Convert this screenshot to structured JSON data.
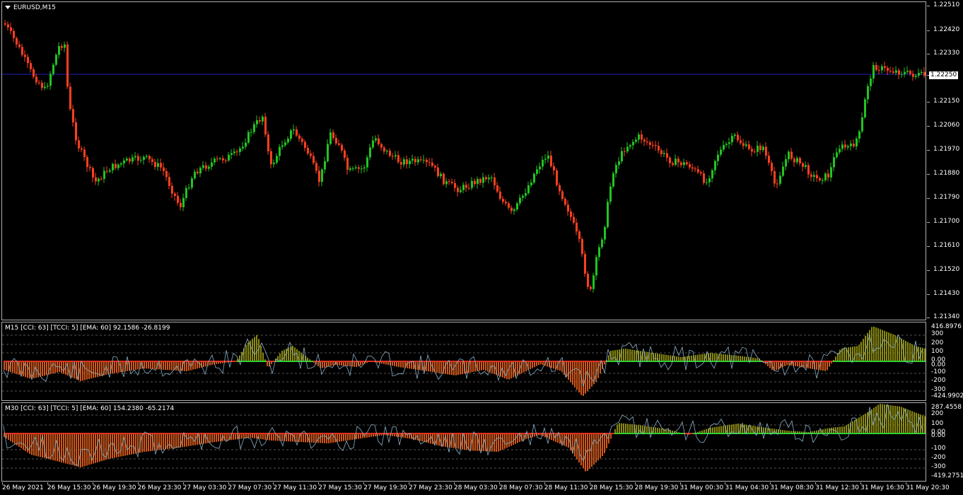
{
  "main": {
    "title": "EURUSD,M15",
    "price_ticks": [
      "1.22510",
      "1.22420",
      "1.22330",
      "1.22250",
      "1.22150",
      "1.22060",
      "1.21970",
      "1.21880",
      "1.21790",
      "1.21700",
      "1.21610",
      "1.21520",
      "1.21430",
      "1.21340"
    ],
    "current_price": "1.22250",
    "colors": {
      "bull": "#22c422",
      "bear": "#ff4020",
      "hline": "#2020c0"
    }
  },
  "indicator1": {
    "title": "M15 [CCI: 63] [TCCI: 5] [EMA: 60] 92.1586 -26.8199",
    "scale_ticks": [
      "416.8976",
      "300",
      "200",
      "100",
      "0.00",
      "0.00",
      "-100",
      "-200",
      "-300",
      "-424.9902"
    ]
  },
  "indicator2": {
    "title": "M30 [CCI: 63] [TCCI: 5] [EMA: 60] 154.2380 -65.2174",
    "scale_ticks": [
      "287.4558",
      "200",
      "100",
      "0.00",
      "0.00",
      "-100",
      "-200",
      "-300",
      "-419.2751"
    ]
  },
  "time_axis": [
    "26 May 2021",
    "26 May 15:30",
    "26 May 19:30",
    "26 May 23:30",
    "27 May 03:30",
    "27 May 07:30",
    "27 May 11:30",
    "27 May 15:30",
    "27 May 19:30",
    "27 May 23:30",
    "28 May 03:30",
    "28 May 07:30",
    "28 May 11:30",
    "28 May 15:30",
    "28 May 19:30",
    "31 May 00:30",
    "31 May 04:30",
    "31 May 08:30",
    "31 May 12:30",
    "31 May 16:30",
    "31 May 20:30"
  ]
}
